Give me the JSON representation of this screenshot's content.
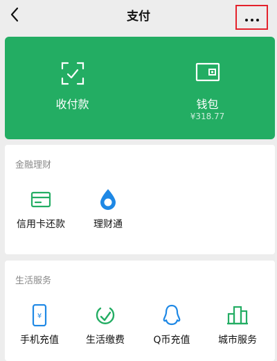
{
  "header": {
    "title": "支付"
  },
  "wallet_card": {
    "collect": {
      "label": "收付款"
    },
    "wallet": {
      "label": "钱包",
      "balance": "¥318.77"
    }
  },
  "finance": {
    "title": "金融理财",
    "items": [
      {
        "label": "信用卡还款",
        "icon": "credit-card-icon"
      },
      {
        "label": "理财通",
        "icon": "drop-icon"
      }
    ]
  },
  "life": {
    "title": "生活服务",
    "items": [
      {
        "label": "手机充值",
        "icon": "phone-icon"
      },
      {
        "label": "生活缴费",
        "icon": "leaf-check-icon"
      },
      {
        "label": "Q币充值",
        "icon": "qq-penguin-icon"
      },
      {
        "label": "城市服务",
        "icon": "city-buildings-icon"
      }
    ]
  },
  "colors": {
    "accent_green": "#23ad63",
    "page_bg": "#ededed",
    "highlight_border": "#e4212b",
    "icon_blue": "#1e88e5"
  }
}
